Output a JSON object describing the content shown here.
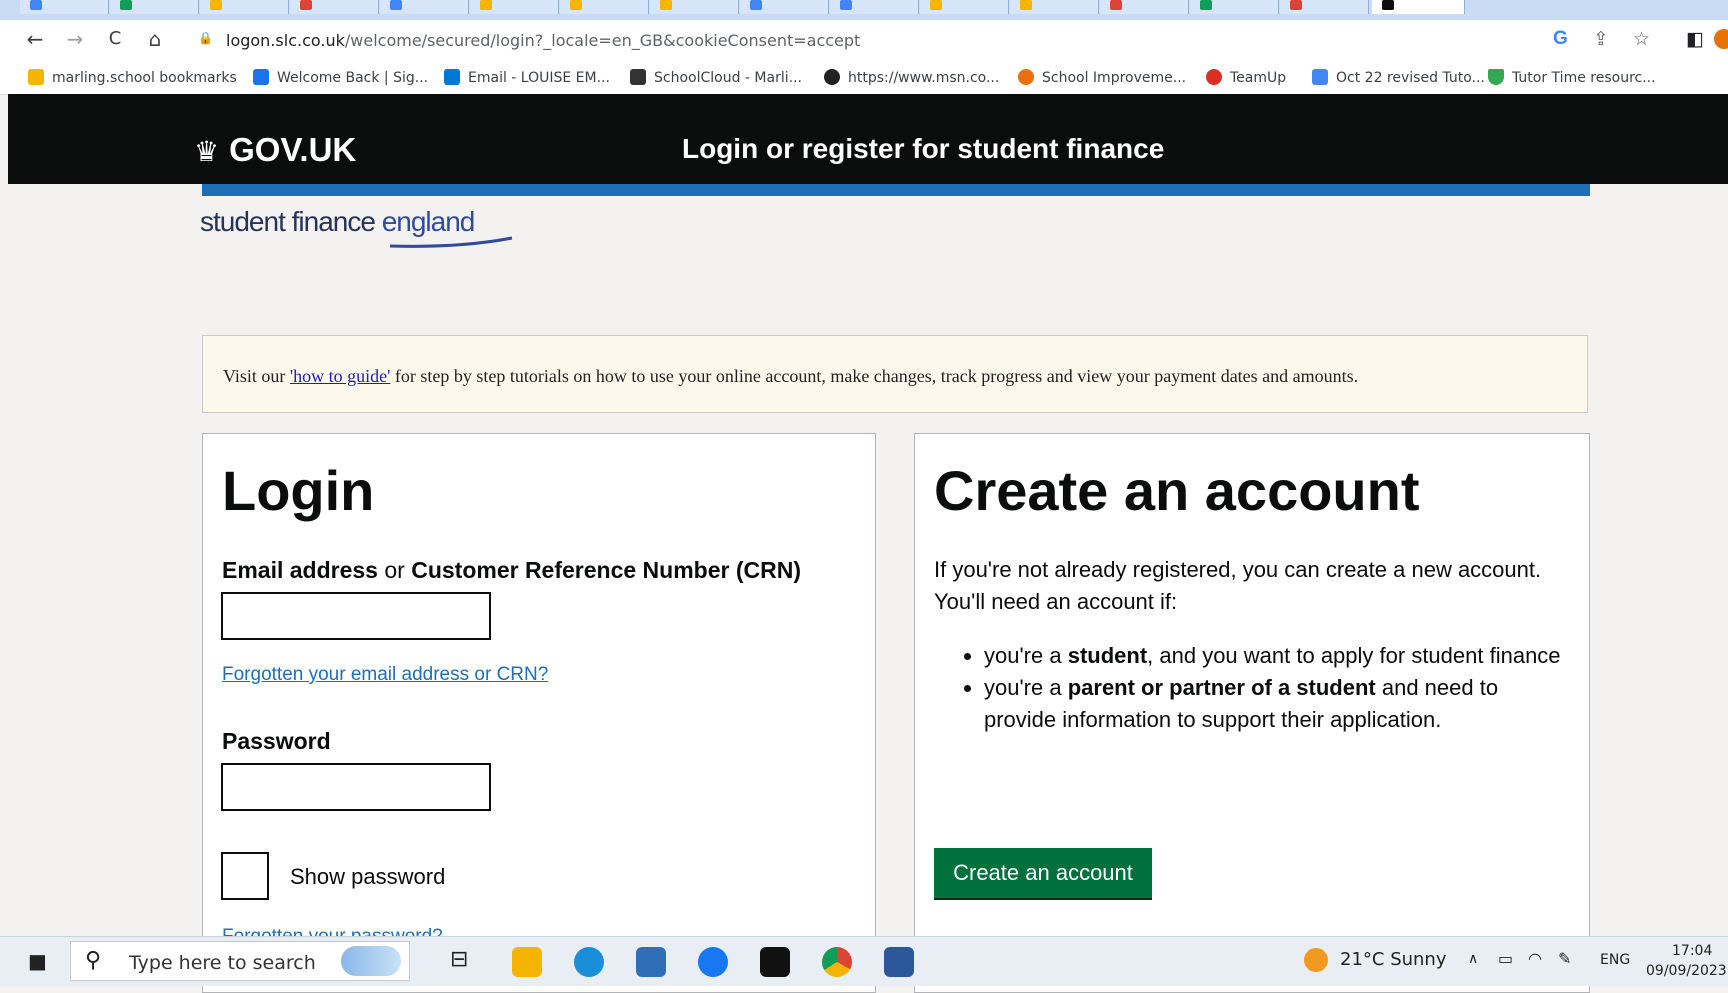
{
  "browser": {
    "url_domain": "logon.slc.co.uk",
    "url_path": "/welcome/secured/login?_locale=en_GB&cookieConsent=accept",
    "bookmarks": [
      {
        "label": "marling.school bookmarks",
        "color": "#f4b400"
      },
      {
        "label": "Welcome Back | Sig...",
        "color": "#1a73e8"
      },
      {
        "label": "Email - LOUISE EM...",
        "color": "#0078d4"
      },
      {
        "label": "SchoolCloud - Marli...",
        "color": "#333333"
      },
      {
        "label": "https://www.msn.co...",
        "color": "#222222"
      },
      {
        "label": "School Improveme...",
        "color": "#e8710a"
      },
      {
        "label": "TeamUp",
        "color": "#d93025"
      },
      {
        "label": "Oct 22 revised Tuto...",
        "color": "#4285f4"
      },
      {
        "label": "Tutor Time resourc...",
        "color": "#34a853"
      }
    ]
  },
  "header": {
    "logo_text": "GOV.UK",
    "service_name": "Login or register for student finance"
  },
  "brand": {
    "part1": "student finance ",
    "part2": "england"
  },
  "notice": {
    "prefix": "Visit our ",
    "link": "'how to guide'",
    "suffix": " for step by step tutorials on how to use your online account, make changes, track progress and view your payment dates and amounts."
  },
  "login": {
    "title": "Login",
    "email_label_bold1": "Email address",
    "email_label_or": " or ",
    "email_label_bold2": "Customer Reference Number (CRN)",
    "email_value": "",
    "forgot_email_link": "Forgotten your email address or CRN?",
    "password_label": "Password",
    "password_value": "",
    "show_password_label": "Show password",
    "forgot_password_link": "Forgotten your password?"
  },
  "create": {
    "title": "Create an account",
    "intro": "If you're not already registered, you can create a new account. You'll need an account if:",
    "bullet1_pre": "you're a ",
    "bullet1_bold": "student",
    "bullet1_post": ", and you want to apply for student finance",
    "bullet2_pre": "you're a ",
    "bullet2_bold": "parent or partner of a student",
    "bullet2_post": " and need to provide information to support their application.",
    "button_label": "Create an account"
  },
  "taskbar": {
    "search_placeholder": "Type here to search",
    "weather": "21°C  Sunny",
    "language": "ENG",
    "time": "17:04",
    "date": "09/09/2023"
  },
  "colors": {
    "gov_black": "#0b0c0c",
    "gov_blue": "#1d70b8",
    "gov_green": "#00703c",
    "link_blue": "#1d70b8"
  }
}
